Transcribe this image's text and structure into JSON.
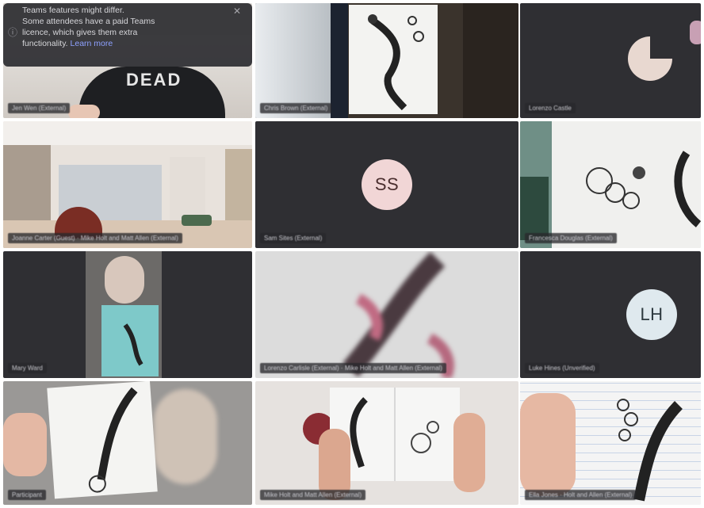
{
  "meeting": {
    "notification": {
      "lines": [
        "Teams features might differ.",
        "Some attendees have a paid Teams",
        "licence, which gives them extra",
        "functionality."
      ],
      "link_label": "Learn more"
    },
    "participants": [
      {
        "name_tag": "Jen Wen (External)",
        "tile_type": "video"
      },
      {
        "name_tag": "Chris Brown (External)",
        "tile_type": "video"
      },
      {
        "name_tag": "Lorenzo Castle",
        "tile_type": "avatar-image"
      },
      {
        "name_tag": "Joanne Carter (Guest) · Mike Holt and Matt Allen (External)",
        "tile_type": "video"
      },
      {
        "name_tag": "Sam Sites (External)",
        "tile_type": "avatar",
        "initials": "SS"
      },
      {
        "name_tag": "Francesca Douglas (External)",
        "tile_type": "video"
      },
      {
        "name_tag": "Mary Ward",
        "tile_type": "video"
      },
      {
        "name_tag": "Lorenzo Carlisle (External) · Mike Holt and Matt Allen (External)",
        "tile_type": "video"
      },
      {
        "name_tag": "Luke Hines (Unverified)",
        "tile_type": "avatar",
        "initials": "LH"
      },
      {
        "name_tag": "Participant",
        "tile_type": "video"
      },
      {
        "name_tag": "Mike Holt and Matt Allen (External)",
        "tile_type": "video"
      },
      {
        "name_tag": "Ella Jones · Holt and Allen (External)",
        "tile_type": "video"
      }
    ]
  },
  "colors": {
    "tile_bg": "#2f2f33",
    "avatar_ss_bg": "#f1d6d6",
    "avatar_ss_fg": "#4a2e2e",
    "avatar_lh_bg": "#dfe9ee",
    "avatar_lh_fg": "#2e3a40"
  }
}
